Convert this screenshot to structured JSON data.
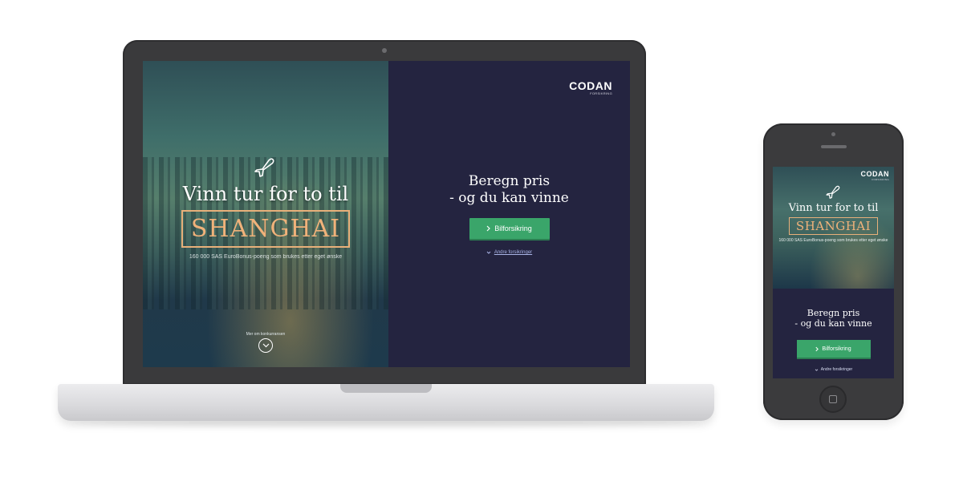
{
  "brand": {
    "name": "CODAN",
    "sub": "FORSIKRING"
  },
  "hero": {
    "title": "Vinn tur for to til",
    "city": "SHANGHAI",
    "subtitle": "160 000 SAS EuroBonus-poeng som brukes etter eget ønske",
    "more_label": "Mer om konkurransen"
  },
  "panel": {
    "title_line1": "Beregn pris",
    "title_line2": "- og du kan vinne",
    "cta_label": "Bilforsikring",
    "other_link": "Andre forsikringer"
  },
  "mobile": {
    "subtitle": "160 000 SAS EuroBonus-poeng som brukes etter eget ønske"
  },
  "colors": {
    "panel_bg": "#242440",
    "cta_green": "#3aa56a",
    "accent_orange": "#f0b27a",
    "link_blue": "#a9b4e6"
  },
  "icons": [
    "plane-icon",
    "chevron-right-icon",
    "chevron-down-icon",
    "circle-chevron-down-icon",
    "home-button-icon"
  ]
}
